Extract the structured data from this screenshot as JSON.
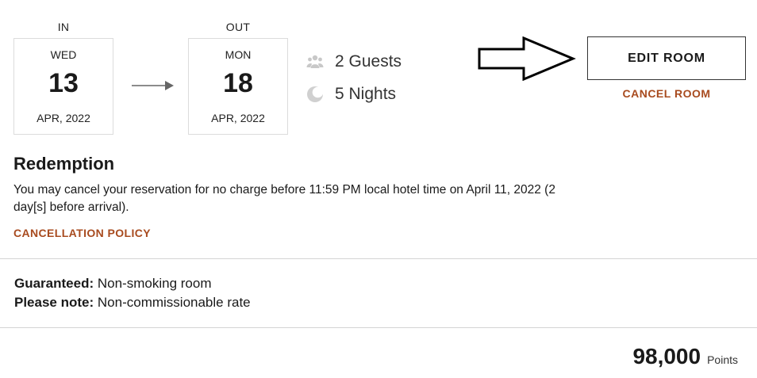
{
  "check_in": {
    "heading": "IN",
    "weekday": "WED",
    "day": "13",
    "month_year": "APR, 2022"
  },
  "check_out": {
    "heading": "OUT",
    "weekday": "MON",
    "day": "18",
    "month_year": "APR, 2022"
  },
  "stay": {
    "guests": "2 Guests",
    "nights": "5 Nights",
    "guests_icon": "guests-icon",
    "nights_icon": "moon-icon"
  },
  "actions": {
    "edit_room": "EDIT ROOM",
    "cancel_room": "CANCEL ROOM"
  },
  "redemption": {
    "title": "Redemption",
    "policy_text": "You may cancel your reservation for no charge before 11:59 PM local hotel time on April 11, 2022 (2 day[s] before arrival).",
    "policy_link": "CANCELLATION POLICY"
  },
  "notes": {
    "guaranteed_label": "Guaranteed:",
    "guaranteed_value": "Non-smoking room",
    "please_note_label": "Please note:",
    "please_note_value": "Non-commissionable rate"
  },
  "total": {
    "value": "98,000",
    "unit": "Points"
  },
  "colors": {
    "accent": "#a84b1f",
    "text": "#1a1a1a",
    "border": "#dcdcdc",
    "icon": "#c8c8c8"
  }
}
